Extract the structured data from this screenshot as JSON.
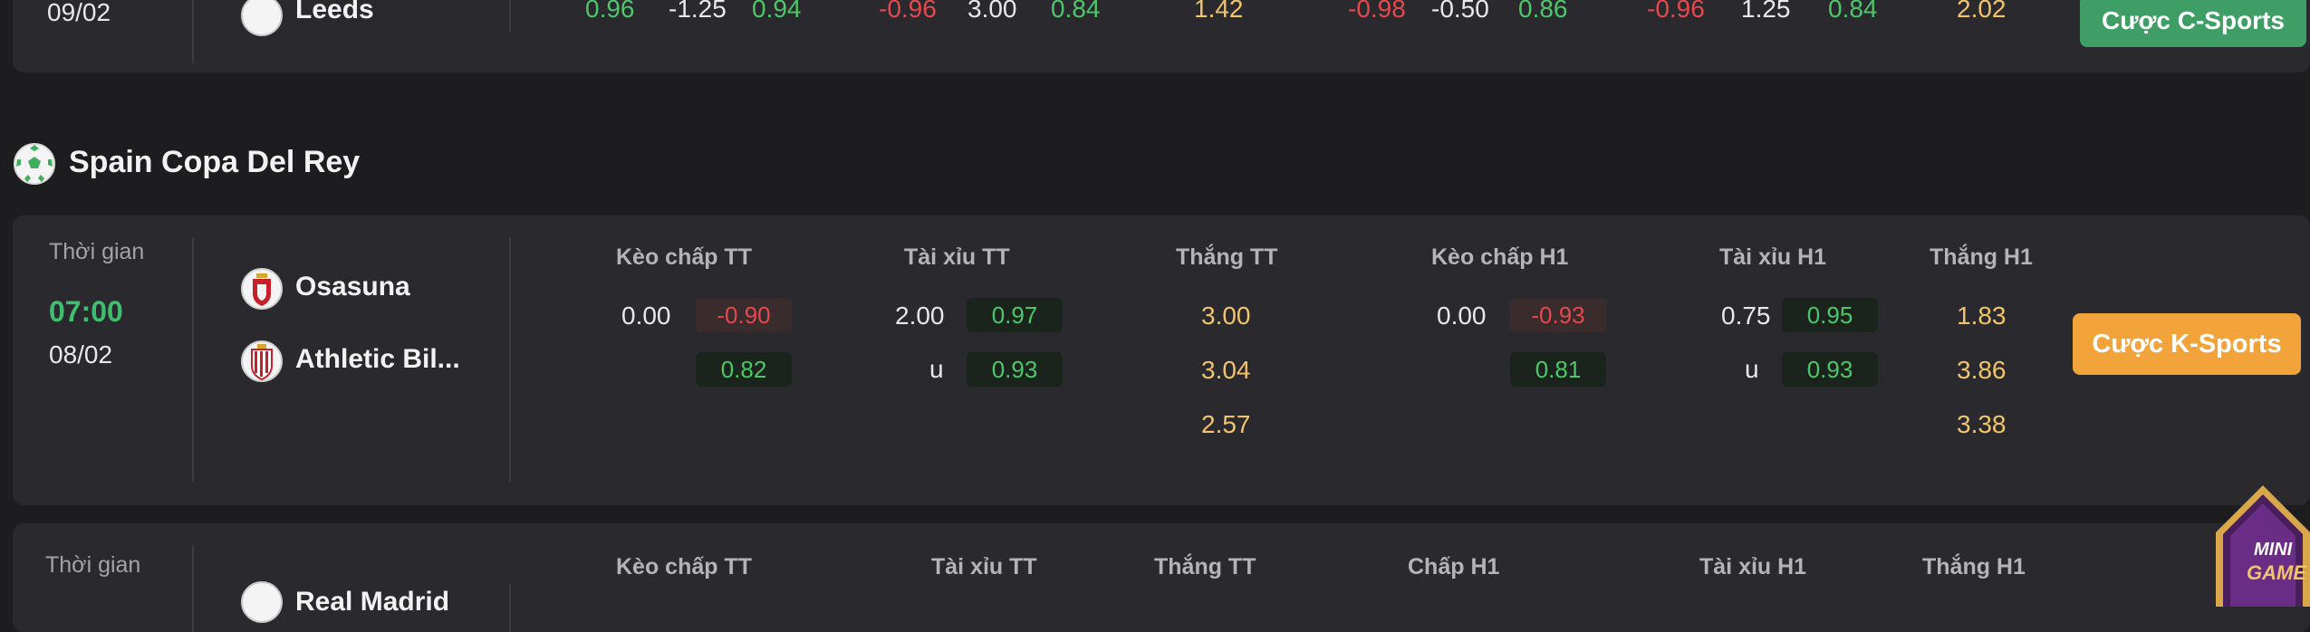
{
  "prev_match": {
    "date": "09/02",
    "team": "Leeds",
    "values": [
      "0.96",
      "-1.25",
      "0.94",
      "-0.96",
      "3.00",
      "0.84",
      "1.42",
      "-0.98",
      "-0.50",
      "0.86",
      "-0.96",
      "1.25",
      "0.84",
      "2.02"
    ],
    "bet_button": "Cược C-Sports"
  },
  "league": {
    "name": "Spain Copa Del Rey"
  },
  "match": {
    "time_label": "Thời gian",
    "time": "07:00",
    "date": "08/02",
    "home_team": "Osasuna",
    "away_team": "Athletic Bil...",
    "headers": [
      "Kèo chấp TT",
      "Tài xỉu TT",
      "Thắng TT",
      "Kèo chấp H1",
      "Tài xỉu H1",
      "Thắng H1"
    ],
    "handicap_ft": {
      "line": "0.00",
      "home": "-0.90",
      "away": "0.82"
    },
    "ou_ft": {
      "line": "2.00",
      "over": "0.97",
      "under_label": "u",
      "under": "0.93"
    },
    "win_ft": [
      "3.00",
      "3.04",
      "2.57"
    ],
    "handicap_h1": {
      "line": "0.00",
      "home": "-0.93",
      "away": "0.81"
    },
    "ou_h1": {
      "line": "0.75",
      "over": "0.95",
      "under_label": "u",
      "under": "0.93"
    },
    "win_h1": [
      "1.83",
      "3.86",
      "3.38"
    ],
    "bet_button": "Cược K-Sports"
  },
  "next_match": {
    "time_label": "Thời gian",
    "team": "Real Madrid",
    "headers": [
      "Kèo chấp TT",
      "Tài xỉu TT",
      "Thắng TT",
      "Chấp H1",
      "Tài xỉu H1",
      "Thắng H1"
    ]
  },
  "mini_game": {
    "line1": "MINI",
    "line2": "GAME"
  },
  "colors": {
    "green_button": "#3f9d66",
    "gold_button": "#f2a43a"
  }
}
